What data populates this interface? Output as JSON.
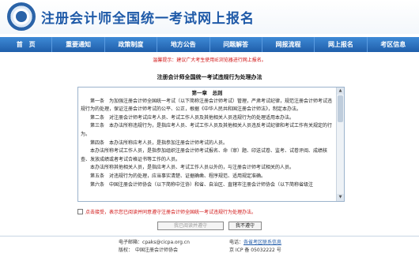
{
  "header": {
    "title": "注册会计师全国统一考试网上报名"
  },
  "nav": [
    "首　页",
    "重要通知",
    "政策制度",
    "地方公告",
    "问题解答",
    "网报流程",
    "网上报名",
    "考区信息"
  ],
  "notice": "温馨提示：建议广大考生使用IE浏览器进行网上报名。",
  "document": {
    "title": "注册会计师全国统一考试违规行为处理办法",
    "chapter": "第一章　总则",
    "paragraphs": [
      "第一条　为加强注册会计师全国统一考试（以下简称注册会计师考试）管理，严肃考试纪律，规范注册会计师考试违规行为的处理，保证注册会计师考试的公平、公正，根据《中华人民共和国注册会计师法》，制定本办法。",
      "第二条　对注册会计师考试应考人员、考试工作人员及其他相关人员违规行为的处理适用本办法。",
      "第三条　本办法所称违规行为，是指应考人员、考试工作人员及其他相关人员违反考试纪律和考试工作有关规定的行为。",
      "第四条　本办法所称应考人员，是指参加注册会计师考试的人员。",
      "本办法所称考试工作人员，是指参加组织注册会计师考试报名、命（审）题、印送试卷、监考、试卷评阅、成绩核查、发放成绩或者考试合格证书等工作的人员。",
      "本办法所称其他相关人员，是指应考人员、考试工作人员以外的，与注册会计师考试相关的人员。",
      "第五条　对违规行为的处理，应当事实清楚、证据确凿、程序规范、适用规定准确。",
      "第六条　中国注册会计师协会（以下简称中注协）和省、自治区、直辖市注册会计师协会（以下简称省级注"
    ]
  },
  "agree": {
    "text": "点击接受，表示您已阅读并同意遵守注册会计师全国统一考试违规行为处理办法。"
  },
  "buttons": {
    "accept": "我已阅读并遵守",
    "reject": "我不遵守"
  },
  "footer": {
    "email_label": "电子邮箱：",
    "email": "cpaks@cicpa.org.cn",
    "contact_label": "电话：",
    "contact_link": "各省考区联系信息",
    "copyright": "版权：　中国注册会计师协会",
    "icp": "京 ICP 备 05032222 号"
  },
  "colors": {
    "brand_blue": "#1f5aa8",
    "nav_blue": "#2a6fbf",
    "warning_red": "#d01010"
  }
}
